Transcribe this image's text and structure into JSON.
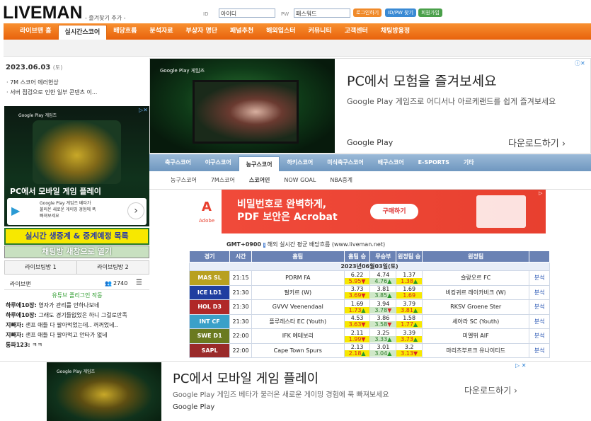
{
  "logo": "LIVEMAN",
  "bookmark": "- 즐겨찾기 추가 -",
  "login": {
    "id_label": "ID",
    "id_value": "아이디",
    "pw_label": "PW",
    "pw_value": "패스워드",
    "login_btn": "로그인하기",
    "find_btn": "ID/PW 찾기",
    "join_btn": "회원가입"
  },
  "nav": [
    "라이브맨 홈",
    "실시간스코어",
    "배당흐름",
    "분석자료",
    "부상자 명단",
    "패널추천",
    "해외입스터",
    "커뮤니티",
    "고객센터",
    "채팅방용정"
  ],
  "left": {
    "date": "2023.06.03",
    "day": "(토)",
    "notices": [
      "7M 스코어 에러현상",
      "서버 점검으로 인한 일부 콘텐츠 이..."
    ],
    "ad_title": "PC에서 모바일 게임 플레이",
    "ad_gp_line1": "Google Play 게임즈 베타가",
    "ad_gp_line2": "불러온 새로운 게이밍 경험에 푹",
    "ad_gp_line3": "빠져보세요",
    "ad_brand": "Google Play 게임즈",
    "banner1": "실시간 생중계 & 중계예정 목록",
    "banner2": "채팅방 새창으로 열기",
    "tabs": [
      "라이브팅방 1",
      "라이브팅방 2"
    ],
    "chat_room": "라이브맨",
    "chat_count": "2740",
    "chat_notice": "유튜브 플리그인 작동",
    "chat": [
      {
        "user": "하루에10장:",
        "msg": "영자가 관리를 안하나보네"
      },
      {
        "user": "하루에10장:",
        "msg": "그래도 경기들없었은 하니 그걸로만족"
      },
      {
        "user": "지빠자:",
        "msg": "샌프 애들 다 팔아먹었는데.. 꺼꺼었네.."
      },
      {
        "user": "지빠자:",
        "msg": "샌프 애들 다 팔아먹고 안타가 없네"
      },
      {
        "user": "통파123:",
        "msg": "ㅋㅋ"
      }
    ]
  },
  "top_ad": {
    "brand": "Google Play 게임즈",
    "title": "PC에서 모험을 즐겨보세요",
    "sub": "Google Play 게임즈로 어디서나 아르케랜드를 쉽게 즐겨보세요",
    "gp": "Google Play",
    "dl": "다운로드하기"
  },
  "sport_tabs": [
    "축구스코어",
    "야구스코어",
    "농구스코어",
    "하키스코어",
    "미식축구스코어",
    "배구스코어",
    "E-SPORTS",
    "기타"
  ],
  "sub_tabs": [
    "농구스코어",
    "7M스코어",
    "스코어인",
    "NOW GOAL",
    "NBA중계"
  ],
  "acrobat": {
    "brand": "Adobe",
    "line1": "비밀번호로 완벽하게,",
    "line2": "PDF 보안은 Acrobat",
    "btn": "구매하기"
  },
  "gmt": "GMT+0900",
  "gmt_note": "해외 실시간 평균 배당흐름 (www.liveman.net)",
  "table": {
    "headers": [
      "경기",
      "시간",
      "홈팀",
      "홈팀 승",
      "무승부",
      "원정팀 승",
      "원정팀",
      ""
    ],
    "date_row": "2023년06월03일(토)",
    "rows": [
      {
        "league": "MAS SL",
        "color": "#b8a020",
        "time": "21:15",
        "home": "PDRM FA",
        "h": [
          "6.22",
          "5.95"
        ],
        "d": [
          "4.74",
          "4.76"
        ],
        "a": [
          "1.37",
          "1.38"
        ],
        "away": "슬랑오르 FC",
        "an": "분석"
      },
      {
        "league": "ICE LD1",
        "color": "#1f3ea0",
        "time": "21:30",
        "home": "필키르 (W)",
        "h": [
          "3.73",
          "3.69"
        ],
        "d": [
          "3.81",
          "3.85"
        ],
        "a": [
          "1.69",
          "1.69"
        ],
        "away": "비킹귀르 레이카비크 (W)",
        "an": "분석"
      },
      {
        "league": "HOL D3",
        "color": "#b02828",
        "time": "21:30",
        "home": "GVVV Veenendaal",
        "h": [
          "1.69",
          "1.73"
        ],
        "d": [
          "3.94",
          "3.78"
        ],
        "a": [
          "3.79",
          "3.81"
        ],
        "away": "RKSV Groene Ster",
        "an": "분석"
      },
      {
        "league": "INT CF",
        "color": "#3aa0c8",
        "time": "21:30",
        "home": "플루레스타 EC (Youth)",
        "h": [
          "4.53",
          "3.63"
        ],
        "d": [
          "3.86",
          "3.58"
        ],
        "a": [
          "1.58",
          "1.77"
        ],
        "away": "세아라 SC (Youth)",
        "an": "분석"
      },
      {
        "league": "SWE D1",
        "color": "#6a7a20",
        "time": "22:00",
        "home": "IFK 예테보리",
        "h": [
          "2.11",
          "1.99"
        ],
        "d": [
          "3.25",
          "3.33"
        ],
        "a": [
          "3.39",
          "3.73"
        ],
        "away": "미엘뷔 AIF",
        "an": "분석"
      },
      {
        "league": "SAPL",
        "color": "#9a2a2a",
        "time": "22:00",
        "home": "Cape Town Spurs",
        "h": [
          "2.13",
          "2.18"
        ],
        "d": [
          "3.01",
          "3.04"
        ],
        "a": [
          "3.2",
          "3.13"
        ],
        "away": "마리츠부르크 유나이티드",
        "an": "분석"
      }
    ]
  },
  "bottom_ad": {
    "brand": "Google Play 게임즈",
    "title": "PC에서 모바일 게임 플레이",
    "sub": "Google Play 게임즈 베타가 불러온 새로운 게이밍 경험에 푹 빠져보세요",
    "gp": "Google Play",
    "dl": "다운로드하기"
  }
}
